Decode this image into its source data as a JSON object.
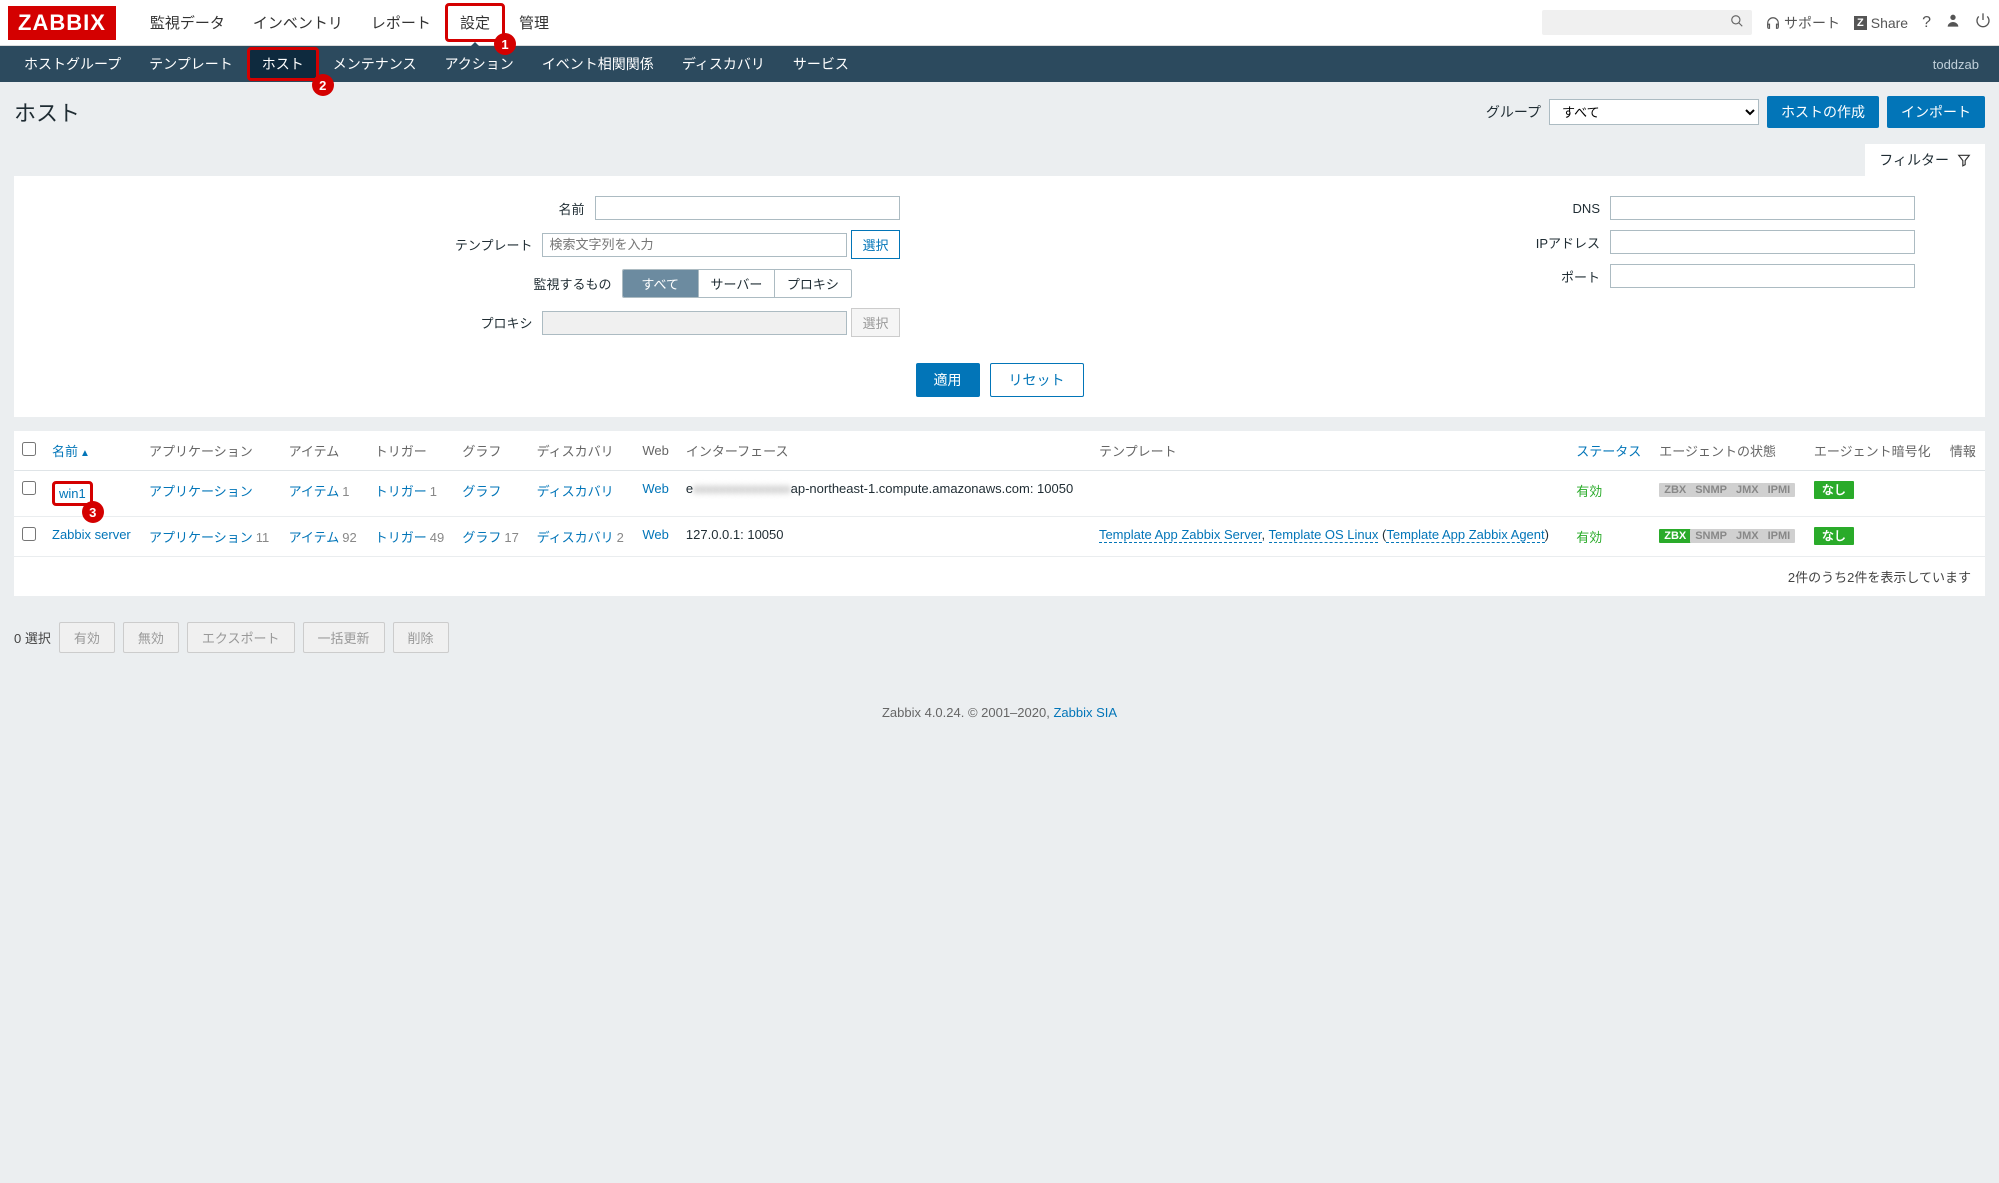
{
  "brand": "ZABBIX",
  "topnav": {
    "monitoring": "監視データ",
    "inventory": "インベントリ",
    "reports": "レポート",
    "config": "設定",
    "admin": "管理"
  },
  "annotations": {
    "num1": "1",
    "num2": "2",
    "num3": "3"
  },
  "topbar": {
    "support": "サポート",
    "share": "Share",
    "help": "?",
    "search_placeholder": ""
  },
  "subnav": {
    "hostgroups": "ホストグループ",
    "templates": "テンプレート",
    "hosts": "ホスト",
    "maintenance": "メンテナンス",
    "actions": "アクション",
    "correlation": "イベント相関関係",
    "discovery": "ディスカバリ",
    "services": "サービス",
    "user": "toddzab"
  },
  "page": {
    "title": "ホスト",
    "group_label": "グループ",
    "group_value": "すべて",
    "create_host": "ホストの作成",
    "import": "インポート",
    "filter_tab": "フィルター"
  },
  "filter": {
    "name": "名前",
    "templates": "テンプレート",
    "templates_placeholder": "検索文字列を入力",
    "select": "選択",
    "monitored_by": "監視するもの",
    "seg_all": "すべて",
    "seg_server": "サーバー",
    "seg_proxy": "プロキシ",
    "proxy": "プロキシ",
    "dns": "DNS",
    "ip": "IPアドレス",
    "port": "ポート",
    "apply": "適用",
    "reset": "リセット"
  },
  "table": {
    "columns": {
      "name": "名前",
      "applications": "アプリケーション",
      "items": "アイテム",
      "triggers": "トリガー",
      "graphs": "グラフ",
      "discovery": "ディスカバリ",
      "web": "Web",
      "interface": "インターフェース",
      "templates": "テンプレート",
      "status": "ステータス",
      "availability": "エージェントの状態",
      "encryption": "エージェント暗号化",
      "info": "情報"
    },
    "rows": [
      {
        "name": "win1",
        "applications": "アプリケーション",
        "items": "アイテム",
        "items_n": "1",
        "triggers": "トリガー",
        "triggers_n": "1",
        "graphs": "グラフ",
        "discovery": "ディスカバリ",
        "web": "Web",
        "interface_prefix": "e",
        "interface_blur": "xxxxxxxxxxxxxxx",
        "interface_suffix": "ap-northeast-1.compute.amazonaws.com: 10050",
        "templates": "",
        "status": "有効",
        "agent_zbx": "grey",
        "encryption": "なし"
      },
      {
        "name": "Zabbix server",
        "applications": "アプリケーション",
        "applications_n": "11",
        "items": "アイテム",
        "items_n": "92",
        "triggers": "トリガー",
        "triggers_n": "49",
        "graphs": "グラフ",
        "graphs_n": "17",
        "discovery": "ディスカバリ",
        "discovery_n": "2",
        "web": "Web",
        "interface": "127.0.0.1: 10050",
        "templates": [
          "Template App Zabbix Server",
          "Template OS Linux",
          "Template App Zabbix Agent"
        ],
        "templates_raw_1": "Template App Zabbix Server",
        "templates_raw_2": "Template OS Linux",
        "templates_raw_3": "Template App Zabbix Agent",
        "status": "有効",
        "agent_zbx": "green",
        "encryption": "なし"
      }
    ],
    "agent_labels": {
      "zbx": "ZBX",
      "snmp": "SNMP",
      "jmx": "JMX",
      "ipmi": "IPMI"
    },
    "footer": "2件のうち2件を表示しています"
  },
  "footer_actions": {
    "selected": "0 選択",
    "enable": "有効",
    "disable": "無効",
    "export": "エクスポート",
    "mass_update": "一括更新",
    "delete": "削除"
  },
  "page_footer": {
    "pre": "Zabbix 4.0.24. © 2001–2020, ",
    "link": "Zabbix SIA"
  }
}
